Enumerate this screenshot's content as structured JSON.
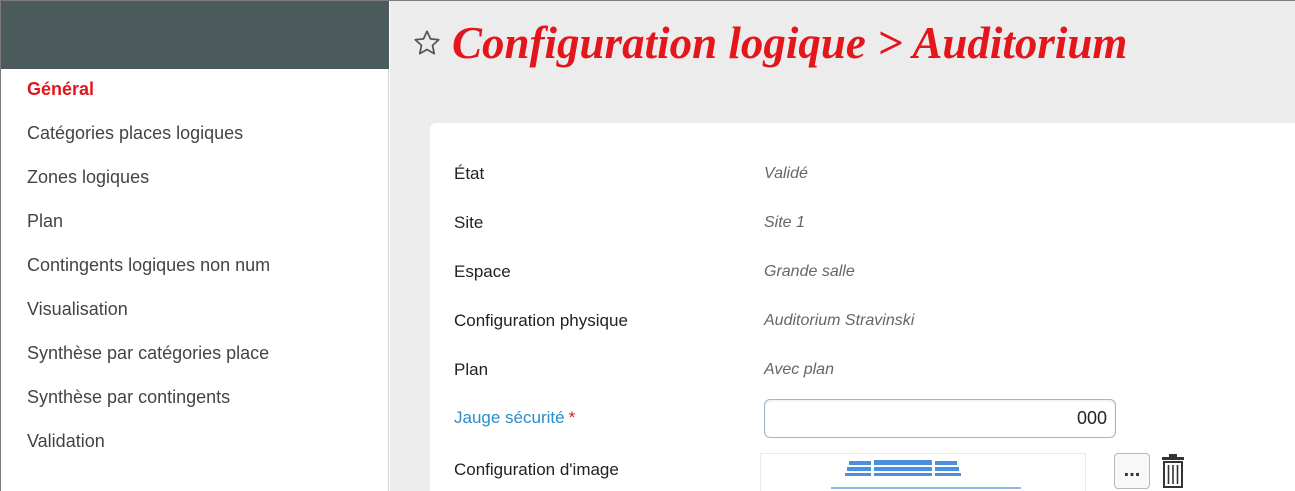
{
  "sidebar": {
    "items": [
      {
        "label": "Général",
        "active": true
      },
      {
        "label": "Catégories places logiques"
      },
      {
        "label": "Zones logiques"
      },
      {
        "label": "Plan"
      },
      {
        "label": "Contingents logiques non num"
      },
      {
        "label": "Visualisation"
      },
      {
        "label": "Synthèse par catégories place"
      },
      {
        "label": "Synthèse par contingents"
      },
      {
        "label": "Validation"
      }
    ]
  },
  "page": {
    "title": "Configuration logique > Auditorium",
    "star_icon": "star-outline-icon"
  },
  "form": {
    "etat": {
      "label": "État",
      "value": "Validé"
    },
    "site": {
      "label": "Site",
      "value": "Site 1"
    },
    "espace": {
      "label": "Espace",
      "value": "Grande salle"
    },
    "config_physique": {
      "label": "Configuration physique",
      "value": "Auditorium Stravinski"
    },
    "plan": {
      "label": "Plan",
      "value": "Avec plan"
    },
    "jauge": {
      "label": "Jauge sécurité",
      "required_mark": "*",
      "value": "000"
    },
    "config_image": {
      "label": "Configuration d'image",
      "browse_label": "...",
      "delete_icon": "trash-icon"
    }
  },
  "colors": {
    "accent": "#e3161b",
    "link": "#2b8ec8",
    "sidebar_header": "#4b5b5b",
    "main_bg": "#ececec"
  }
}
